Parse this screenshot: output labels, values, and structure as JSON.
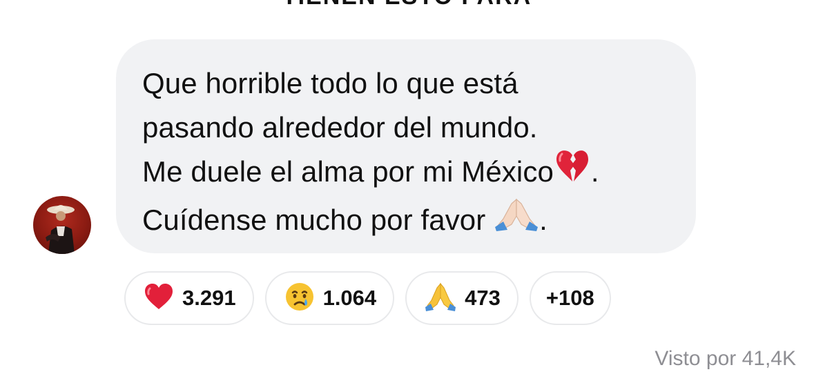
{
  "header": {
    "cutoff_text": "TIENEN ESTO PARA"
  },
  "message": {
    "lines": [
      "Que horrible todo lo que está",
      "pasando alrededor del mundo.",
      "Me duele el alma por mi México",
      "Cuídense mucho por favor "
    ],
    "line3_suffix": ".",
    "line4_suffix": ".",
    "icons": {
      "line3": "broken-heart-icon",
      "line4": "praying-hands-icon"
    }
  },
  "reactions": [
    {
      "icon": "red-heart-icon",
      "count": "3.291"
    },
    {
      "icon": "crying-face-icon",
      "count": "1.064"
    },
    {
      "icon": "praying-hands-icon",
      "count": "473"
    },
    {
      "icon": "",
      "count": "+108"
    }
  ],
  "footer": {
    "seen_text": "Visto por 41,4K"
  },
  "colors": {
    "bubble_bg": "#f1f2f4",
    "pill_border": "#e8e9eb",
    "muted_text": "#8e8e93",
    "avatar_bg": "#8a1b12"
  }
}
